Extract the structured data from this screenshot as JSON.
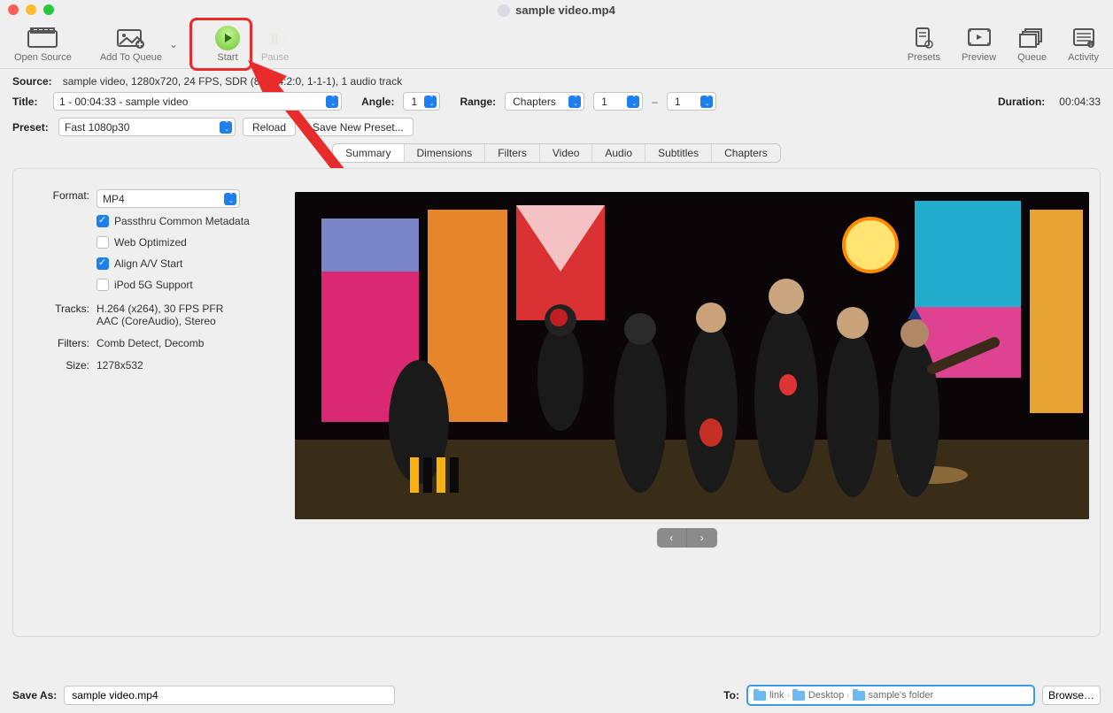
{
  "window": {
    "title": "sample video.mp4"
  },
  "toolbar": {
    "open_source": "Open Source",
    "add_to_queue": "Add To Queue",
    "start": "Start",
    "pause": "Pause",
    "right": {
      "presets": "Presets",
      "preview": "Preview",
      "queue": "Queue",
      "activity": "Activity"
    }
  },
  "source": {
    "label": "Source:",
    "value": "sample video, 1280x720, 24 FPS, SDR (8-bit 4:2:0, 1-1-1), 1 audio track"
  },
  "title": {
    "label": "Title:",
    "value": "1 - 00:04:33 - sample video"
  },
  "angle": {
    "label": "Angle:",
    "value": "1"
  },
  "range": {
    "label": "Range:",
    "mode": "Chapters",
    "from": "1",
    "sep": "–",
    "to": "1"
  },
  "duration": {
    "label": "Duration:",
    "value": "00:04:33"
  },
  "preset": {
    "label": "Preset:",
    "selected": "Fast 1080p30",
    "reload": "Reload",
    "save_new": "Save New Preset..."
  },
  "tabs": [
    "Summary",
    "Dimensions",
    "Filters",
    "Video",
    "Audio",
    "Subtitles",
    "Chapters"
  ],
  "summary": {
    "format_label": "Format:",
    "format": "MP4",
    "passthru": "Passthru Common Metadata",
    "web_optimized": "Web Optimized",
    "align_av": "Align A/V Start",
    "ipod_5g": "iPod 5G Support",
    "tracks_label": "Tracks:",
    "tracks_line1": "H.264 (x264), 30 FPS PFR",
    "tracks_line2": "AAC (CoreAudio), Stereo",
    "filters_label": "Filters:",
    "filters": "Comb Detect, Decomb",
    "size_label": "Size:",
    "size": "1278x532"
  },
  "footer": {
    "save_as_label": "Save As:",
    "save_as": "sample video.mp4",
    "to_label": "To:",
    "path": [
      "link",
      "Desktop",
      "sample's folder"
    ],
    "browse": "Browse…"
  }
}
